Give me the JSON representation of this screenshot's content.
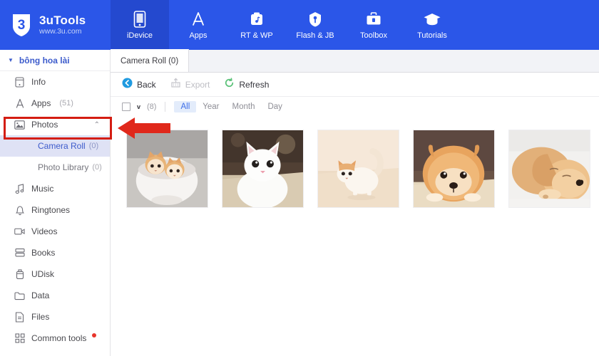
{
  "header": {
    "logo": {
      "mark": "shield-3-logo",
      "title": "3uTools",
      "subtitle": "www.3u.com"
    },
    "tabs": [
      {
        "label": "iDevice",
        "icon": "phone-icon",
        "active": true
      },
      {
        "label": "Apps",
        "icon": "appstore-icon",
        "active": false
      },
      {
        "label": "RT & WP",
        "icon": "ringtone-wallpaper-icon",
        "active": false
      },
      {
        "label": "Flash & JB",
        "icon": "flash-jailbreak-icon",
        "active": false
      },
      {
        "label": "Toolbox",
        "icon": "toolbox-icon",
        "active": false
      },
      {
        "label": "Tutorials",
        "icon": "graduation-cap-icon",
        "active": false
      }
    ]
  },
  "sidebar": {
    "device": {
      "name": "bông hoa lài",
      "caret": "caret-down-icon"
    },
    "items": [
      {
        "label": "Info",
        "icon": "device-info-icon",
        "count": "",
        "chevron": "",
        "badge": false
      },
      {
        "label": "Apps",
        "icon": "appstore-icon",
        "count": "(51)",
        "chevron": "",
        "badge": false
      },
      {
        "label": "Photos",
        "icon": "photo-icon",
        "count": "",
        "chevron": "chevron-up-icon",
        "badge": false
      },
      {
        "label": "Music",
        "icon": "music-note-icon",
        "count": "",
        "chevron": "",
        "badge": false
      },
      {
        "label": "Ringtones",
        "icon": "bell-icon",
        "count": "",
        "chevron": "",
        "badge": false
      },
      {
        "label": "Videos",
        "icon": "video-camera-icon",
        "count": "",
        "chevron": "",
        "badge": false
      },
      {
        "label": "Books",
        "icon": "books-icon",
        "count": "",
        "chevron": "",
        "badge": false
      },
      {
        "label": "UDisk",
        "icon": "usb-disk-icon",
        "count": "",
        "chevron": "",
        "badge": false
      },
      {
        "label": "Data",
        "icon": "folder-icon",
        "count": "",
        "chevron": "",
        "badge": false
      },
      {
        "label": "Files",
        "icon": "file-icon",
        "count": "",
        "chevron": "",
        "badge": false
      },
      {
        "label": "Common tools",
        "icon": "grid-squares-icon",
        "count": "",
        "chevron": "",
        "badge": true
      }
    ],
    "sub_items": [
      {
        "label": "Camera Roll",
        "count": "(0)",
        "selected": true
      },
      {
        "label": "Photo Library",
        "count": "(0)",
        "selected": false
      }
    ]
  },
  "main": {
    "tab": {
      "label": "Camera Roll (0)"
    },
    "toolbar": [
      {
        "label": "Back",
        "icon": "back-circle-icon",
        "disabled": false
      },
      {
        "label": "Export",
        "icon": "export-box-icon",
        "disabled": true
      },
      {
        "label": "Refresh",
        "icon": "refresh-circle-icon",
        "disabled": false
      }
    ],
    "filter": {
      "select_all_checked": false,
      "caret": "caret-down-icon",
      "count": "(8)",
      "options": [
        {
          "label": "All",
          "active": true
        },
        {
          "label": "Year",
          "active": false
        },
        {
          "label": "Month",
          "active": false
        },
        {
          "label": "Day",
          "active": false
        }
      ]
    },
    "thumbnails": [
      {
        "alt": "two-ginger-kittens-in-white-bowl"
      },
      {
        "alt": "white-cat-looking-up"
      },
      {
        "alt": "orange-and-white-kitten-standing"
      },
      {
        "alt": "pomeranian-puppy-lying-down"
      },
      {
        "alt": "golden-retriever-puppy-sleeping"
      }
    ]
  },
  "annotations": {
    "highlight_box_target": "Photos",
    "arrow_direction": "left",
    "color": "#d41d12"
  },
  "colors": {
    "brand_blue": "#2b56e8",
    "active_tab_blue": "#2449cf",
    "accent_blue": "#3d5ccc",
    "selection_blue": "#dfe2f5",
    "annotation_red": "#d41d12",
    "refresh_green": "#5cc27a"
  }
}
